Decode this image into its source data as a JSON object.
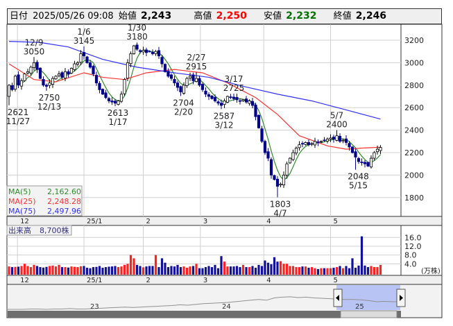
{
  "header": {
    "date_label": "日付",
    "datetime": "2025/05/26 09:08",
    "open_label": "始値",
    "open": "2,243",
    "high_label": "高値",
    "high": "2,250",
    "low_label": "安値",
    "low": "2,232",
    "close_label": "終値",
    "close": "2,246",
    "colors": {
      "high": "#ff0000",
      "low": "#007000",
      "text": "#111111"
    }
  },
  "legend": {
    "ma5": {
      "label": "MA(5)",
      "value": "2,162.60",
      "color": "#2e8b2e"
    },
    "ma25": {
      "label": "MA(25)",
      "value": "2,248.28",
      "color": "#ff3030"
    },
    "ma75": {
      "label": "MA(75)",
      "value": "2,497.96",
      "color": "#3030ff"
    }
  },
  "volume_legend": {
    "label": "出来高",
    "value": "8,700株"
  },
  "volume_unit": "(万株)",
  "navigator_labels": [
    "23",
    "24",
    "25"
  ],
  "chart_data": {
    "type": "candlestick",
    "price_axis": {
      "ticks": [
        "3200",
        "3000",
        "2800",
        "2600",
        "2400",
        "2200",
        "2000",
        "1800"
      ],
      "range": [
        1700,
        3300
      ]
    },
    "volume_axis": {
      "ticks": [
        "16.0",
        "12.0",
        "8.0",
        "4.0"
      ],
      "range": [
        0,
        18
      ],
      "unit": "万株"
    },
    "month_labels": [
      {
        "label": "12",
        "index": 2.7
      },
      {
        "label": "25/1",
        "index": 24
      },
      {
        "label": "2",
        "index": 43
      },
      {
        "label": "3",
        "index": 61.3
      },
      {
        "label": "4",
        "index": 81.6
      },
      {
        "label": "5",
        "index": 103
      }
    ],
    "close": [
      2800,
      2760,
      2880,
      2800,
      2840,
      2900,
      2920,
      2960,
      3000,
      2940,
      2860,
      2800,
      2790,
      2820,
      2860,
      2880,
      2900,
      2870,
      2920,
      2900,
      2950,
      2990,
      3000,
      3080,
      3060,
      3000,
      2960,
      2900,
      2820,
      2760,
      2720,
      2690,
      2660,
      2650,
      2640,
      2660,
      2720,
      2850,
      3000,
      3080,
      3150,
      3120,
      3100,
      3110,
      3090,
      3100,
      3080,
      3100,
      3060,
      2990,
      2920,
      2880,
      2860,
      2820,
      2780,
      2740,
      2800,
      2860,
      2880,
      2840,
      2860,
      2800,
      2760,
      2720,
      2700,
      2680,
      2660,
      2640,
      2620,
      2660,
      2700,
      2690,
      2680,
      2670,
      2660,
      2670,
      2650,
      2660,
      2620,
      2520,
      2420,
      2300,
      2200,
      2150,
      2000,
      1960,
      1900,
      1920,
      2000,
      2100,
      2150,
      2200,
      2240,
      2270,
      2280,
      2290,
      2270,
      2280,
      2300,
      2290,
      2300,
      2310,
      2320,
      2330,
      2320,
      2350,
      2300,
      2310,
      2290,
      2250,
      2200,
      2160,
      2120,
      2110,
      2100,
      2080,
      2150,
      2200,
      2230,
      2246
    ],
    "first_open": 2700,
    "volume": [
      2.8,
      2.5,
      2.6,
      2.7,
      3.0,
      4.0,
      3.0,
      2.5,
      3.5,
      3.0,
      2.5,
      2.3,
      2.6,
      3.0,
      3.2,
      2.8,
      3.5,
      2.5,
      2.5,
      2.3,
      2.8,
      2.6,
      2.5,
      2.9,
      3.0,
      2.2,
      2.0,
      2.5,
      2.6,
      3.0,
      2.2,
      2.5,
      2.7,
      2.8,
      3.0,
      2.5,
      2.8,
      3.5,
      4.0,
      8.0,
      6.5,
      3.5,
      3.0,
      2.4,
      2.8,
      3.0,
      3.0,
      8.0,
      2.5,
      6.5,
      4.5,
      2.5,
      3.0,
      2.8,
      3.5,
      2.5,
      2.8,
      2.2,
      2.8,
      3.0,
      4.0,
      2.0,
      2.0,
      2.5,
      3.0,
      2.5,
      3.5,
      2.0,
      7.5,
      5.0,
      2.8,
      2.8,
      2.8,
      3.0,
      2.5,
      3.5,
      2.5,
      2.5,
      3.0,
      2.2,
      3.5,
      3.0,
      5.5,
      4.5,
      3.8,
      7.0,
      5.0,
      5.2,
      4.0,
      4.0,
      3.0,
      3.0,
      2.5,
      2.5,
      2.8,
      2.8,
      2.2,
      2.5,
      2.0,
      1.6,
      2.0,
      2.0,
      2.0,
      2.0,
      2.2,
      2.5,
      3.0,
      2.0,
      3.0,
      2.0,
      6.5,
      2.2,
      3.2,
      16.5,
      3.2,
      2.5,
      3.0,
      2.5,
      2.5,
      3.5
    ],
    "ma25": [
      [
        0,
        2990
      ],
      [
        8,
        2850
      ],
      [
        15,
        2830
      ],
      [
        24,
        2910
      ],
      [
        30,
        2870
      ],
      [
        37,
        2850
      ],
      [
        44,
        2910
      ],
      [
        53,
        2940
      ],
      [
        62,
        2910
      ],
      [
        70,
        2820
      ],
      [
        79,
        2690
      ],
      [
        86,
        2540
      ],
      [
        93,
        2350
      ],
      [
        102,
        2260
      ],
      [
        108,
        2230
      ],
      [
        113,
        2240
      ],
      [
        119,
        2248
      ]
    ],
    "ma75": [
      [
        0,
        3190
      ],
      [
        10,
        3180
      ],
      [
        19,
        3140
      ],
      [
        30,
        3030
      ],
      [
        41,
        2960
      ],
      [
        53,
        2910
      ],
      [
        64,
        2870
      ],
      [
        75,
        2790
      ],
      [
        86,
        2720
      ],
      [
        97,
        2660
      ],
      [
        108,
        2580
      ],
      [
        119,
        2498
      ]
    ],
    "annotations": [
      {
        "price": "2621",
        "date": "11/27",
        "index": 0,
        "value": 2621,
        "pos": "below"
      },
      {
        "price": "3050",
        "date": "12/9",
        "index": 8,
        "value": 3050,
        "pos": "above"
      },
      {
        "price": "2750",
        "date": "12/13",
        "index": 12,
        "value": 2750,
        "pos": "below"
      },
      {
        "price": "3145",
        "date": "1/6",
        "index": 24,
        "value": 3145,
        "pos": "above"
      },
      {
        "price": "2613",
        "date": "1/17",
        "index": 34,
        "value": 2613,
        "pos": "below"
      },
      {
        "price": "3180",
        "date": "1/30",
        "index": 41,
        "value": 3180,
        "pos": "above"
      },
      {
        "price": "2704",
        "date": "2/20",
        "index": 55,
        "value": 2704,
        "pos": "below"
      },
      {
        "price": "2915",
        "date": "2/27",
        "index": 60,
        "value": 2915,
        "pos": "above"
      },
      {
        "price": "2587",
        "date": "3/12",
        "index": 68,
        "value": 2587,
        "pos": "below"
      },
      {
        "price": "2725",
        "date": "3/17",
        "index": 72,
        "value": 2725,
        "pos": "above"
      },
      {
        "price": "1803",
        "date": "4/7",
        "index": 86,
        "value": 1803,
        "pos": "below"
      },
      {
        "price": "2400",
        "date": "5/7",
        "index": 105,
        "value": 2400,
        "pos": "above"
      },
      {
        "price": "2048",
        "date": "5/15",
        "index": 111,
        "value": 2048,
        "pos": "below"
      }
    ],
    "colors": {
      "up_body": "#ffffff",
      "down_body": "#00008b",
      "vol_up": "#ff2020",
      "vol_down": "#10109a"
    }
  },
  "navigator": {
    "series": [
      40,
      40,
      40,
      41,
      41,
      40,
      41,
      41,
      42,
      41,
      41,
      42,
      43,
      44,
      45,
      46,
      45,
      46,
      47,
      48,
      49,
      50,
      52,
      51,
      53,
      55,
      56,
      57,
      58,
      60,
      62,
      64,
      66,
      64,
      70,
      72,
      73,
      71,
      72,
      70,
      69,
      68,
      67,
      66,
      66,
      65,
      63,
      60,
      61,
      60,
      60
    ]
  }
}
